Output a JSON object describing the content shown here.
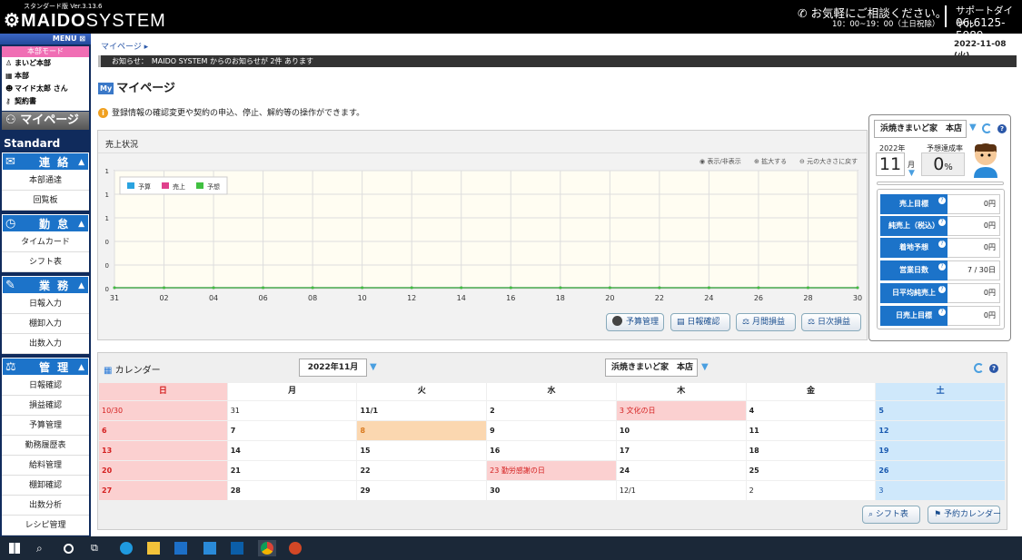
{
  "header": {
    "version": "スタンダード版 Ver.3.13.6",
    "logo_main": "MAIDO",
    "logo_sub": "SYSTEM",
    "consult": "お気軽にご相談ください。",
    "hours": "10：00~19：00（土日祝除）",
    "support_label": "サポートダイヤル",
    "phone": "06-6125-5989"
  },
  "sidebar": {
    "menu_label": "MENU",
    "mode_label": "本部モード",
    "mode_items": [
      {
        "icon": "user-icon",
        "label": "まいど本部"
      },
      {
        "icon": "building-icon",
        "label": "本部"
      },
      {
        "icon": "person-icon",
        "label": "マイド太郎 さん"
      },
      {
        "icon": "key-icon",
        "label": "契約書"
      }
    ],
    "mypage": "マイページ",
    "edition": "Standard",
    "sections": [
      {
        "icon": "mail-icon",
        "title": "連 絡",
        "items": [
          "本部通達",
          "回覧板"
        ]
      },
      {
        "icon": "clock-icon",
        "title": "勤 怠",
        "items": [
          "タイムカード",
          "シフト表"
        ]
      },
      {
        "icon": "pen-icon",
        "title": "業 務",
        "items": [
          "日報入力",
          "棚卸入力",
          "出数入力"
        ]
      },
      {
        "icon": "scale-icon",
        "title": "管 理",
        "items": [
          "日報確認",
          "損益確認",
          "予算管理",
          "勤務履歴表",
          "給料管理",
          "棚卸確認",
          "出数分析",
          "レシピ管理"
        ]
      }
    ]
  },
  "breadcrumb": "マイページ ▸",
  "date": "2022-11-08 (火)",
  "notice": "お知らせ：　MAIDO SYSTEM からのお知らせが 2件 あります",
  "page_title": "マイページ",
  "page_title_badge": "My",
  "info_text": "登録情報の確認変更や契約の申込、停止、解約等の操作ができます。",
  "sales_panel": {
    "title": "売上状況",
    "controls": [
      "表示/非表示",
      "拡大する",
      "元の大きさに戻す"
    ],
    "buttons": [
      "予算管理",
      "日報確認",
      "月間損益",
      "日次損益"
    ]
  },
  "chart_data": {
    "type": "line",
    "x": [
      "31",
      "02",
      "04",
      "06",
      "08",
      "10",
      "12",
      "14",
      "16",
      "18",
      "20",
      "22",
      "24",
      "26",
      "28",
      "30"
    ],
    "y_ticks": [
      "1",
      "1",
      "1",
      "0",
      "0",
      "0"
    ],
    "series": [
      {
        "name": "予算",
        "color": "#2aa3e0",
        "values": [
          0,
          0,
          0,
          0,
          0,
          0,
          0,
          0,
          0,
          0,
          0,
          0,
          0,
          0,
          0,
          0
        ]
      },
      {
        "name": "売上",
        "color": "#e0408c",
        "values": [
          0,
          0,
          0,
          0,
          0,
          0,
          0,
          0,
          0,
          0,
          0,
          0,
          0,
          0,
          0,
          0
        ]
      },
      {
        "name": "予想",
        "color": "#40c040",
        "values": [
          0,
          0,
          0,
          0,
          0,
          0,
          0,
          0,
          0,
          0,
          0,
          0,
          0,
          0,
          0,
          0
        ]
      }
    ]
  },
  "right_panel": {
    "store": "浜焼きまいど家　本店",
    "year": "2022年",
    "month": "11",
    "month_unit": "月",
    "rate_label": "予想達成率",
    "rate_value": "0",
    "rate_unit": "%",
    "stats": [
      {
        "label": "売上目標",
        "value": "0円"
      },
      {
        "label": "純売上（税込）",
        "value": "0円"
      },
      {
        "label": "着地予想",
        "value": "0円"
      },
      {
        "label": "営業日数",
        "value": "7 / 30日"
      },
      {
        "label": "日平均純売上",
        "value": "0円"
      },
      {
        "label": "日売上目標",
        "value": "0円"
      }
    ]
  },
  "calendar": {
    "title": "カレンダー",
    "month": "2022年11月",
    "store": "浜焼きまいど家　本店",
    "weekdays": [
      "日",
      "月",
      "火",
      "水",
      "木",
      "金",
      "土"
    ],
    "weeks": [
      [
        "10/30",
        "31",
        "11/1",
        "2",
        "3 文化の日",
        "4",
        "5"
      ],
      [
        "6",
        "7",
        "8",
        "9",
        "10",
        "11",
        "12"
      ],
      [
        "13",
        "14",
        "15",
        "16",
        "17",
        "18",
        "19"
      ],
      [
        "20",
        "21",
        "22",
        "23 勤労感謝の日",
        "24",
        "25",
        "26"
      ],
      [
        "27",
        "28",
        "29",
        "30",
        "12/1",
        "2",
        "3"
      ]
    ],
    "buttons": [
      "シフト表",
      "予約カレンダー"
    ]
  },
  "colors": {
    "accent": "#1c73c9",
    "sunday_bg": "#fbd0d0",
    "saturday_bg": "#cfe8fb",
    "today_bg": "#fbd7b0",
    "holiday_bg": "#fbd0d0"
  }
}
